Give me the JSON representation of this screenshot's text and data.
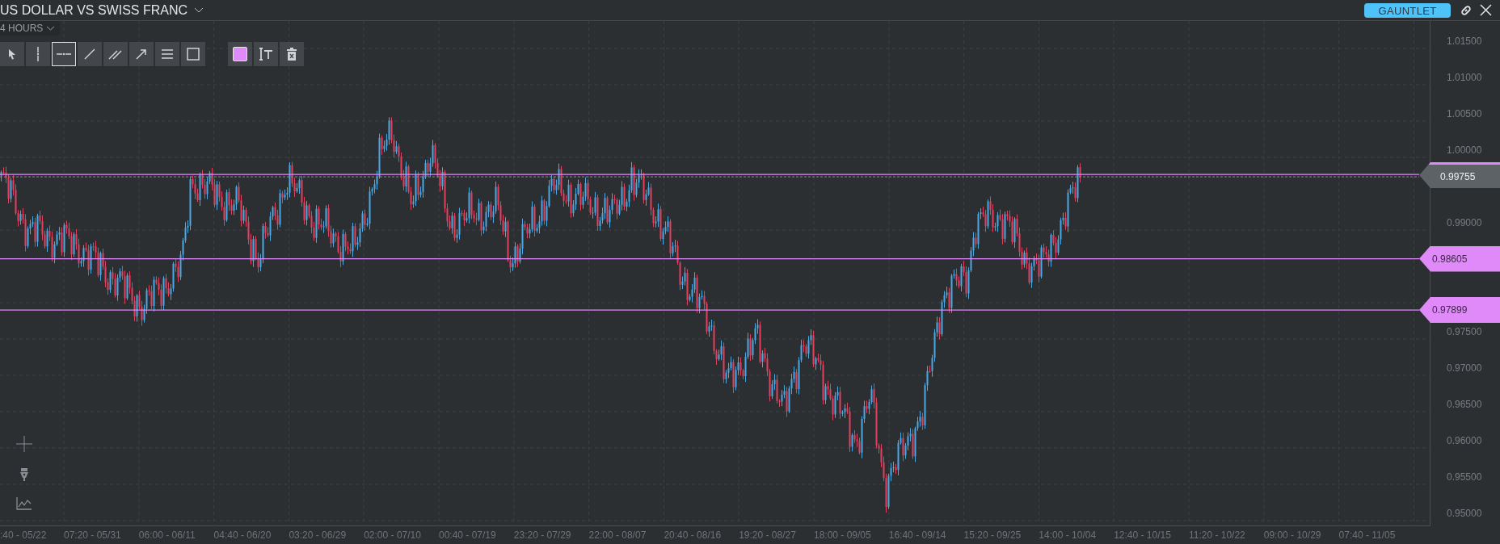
{
  "header": {
    "title": "US DOLLAR VS SWISS FRANC",
    "badge": "GAUNTLET"
  },
  "timeframe": "4 HOURS",
  "tools": [
    {
      "kind": "pointer",
      "selected": false
    },
    {
      "kind": "vertical-line",
      "selected": false
    },
    {
      "kind": "horizontal-line",
      "selected": true
    },
    {
      "kind": "trend-line",
      "selected": false
    },
    {
      "kind": "parallel-lines",
      "selected": false
    },
    {
      "kind": "arrow-line",
      "selected": false
    },
    {
      "kind": "lines",
      "selected": false
    },
    {
      "kind": "rectangle",
      "selected": false
    }
  ],
  "style_tools": [
    {
      "kind": "color",
      "color": "#df8af8"
    },
    {
      "kind": "text"
    },
    {
      "kind": "delete"
    }
  ],
  "side_tools": [
    {
      "kind": "crosshair"
    },
    {
      "kind": "pen"
    },
    {
      "kind": "indicator"
    }
  ],
  "price_axis": [
    "1.01500",
    "1.01000",
    "1.00500",
    "1.00000",
    "0.99000",
    "0.97500",
    "0.97000",
    "0.96500",
    "0.96000",
    "0.95500",
    "0.95000"
  ],
  "price_lines": [
    {
      "price": "0.99755",
      "selected": true
    },
    {
      "price": "0.98605",
      "selected": false
    },
    {
      "price": "0.97899",
      "selected": false
    }
  ],
  "time_axis": [
    ":40 - 05/22",
    "07:20 - 05/31",
    "06:00 - 06/11",
    "04:40 - 06/20",
    "03:20 - 06/29",
    "02:00 - 07/10",
    "00:40 - 07/19",
    "23:20 - 07/29",
    "22:00 - 08/07",
    "20:40 - 08/16",
    "19:20 - 08/27",
    "18:00 - 09/05",
    "16:40 - 09/14",
    "15:20 - 09/25",
    "14:00 - 10/04",
    "12:40 - 10/15",
    "11:20 - 10/22",
    "09:00 - 10/29",
    "07:40 - 11/05"
  ]
}
